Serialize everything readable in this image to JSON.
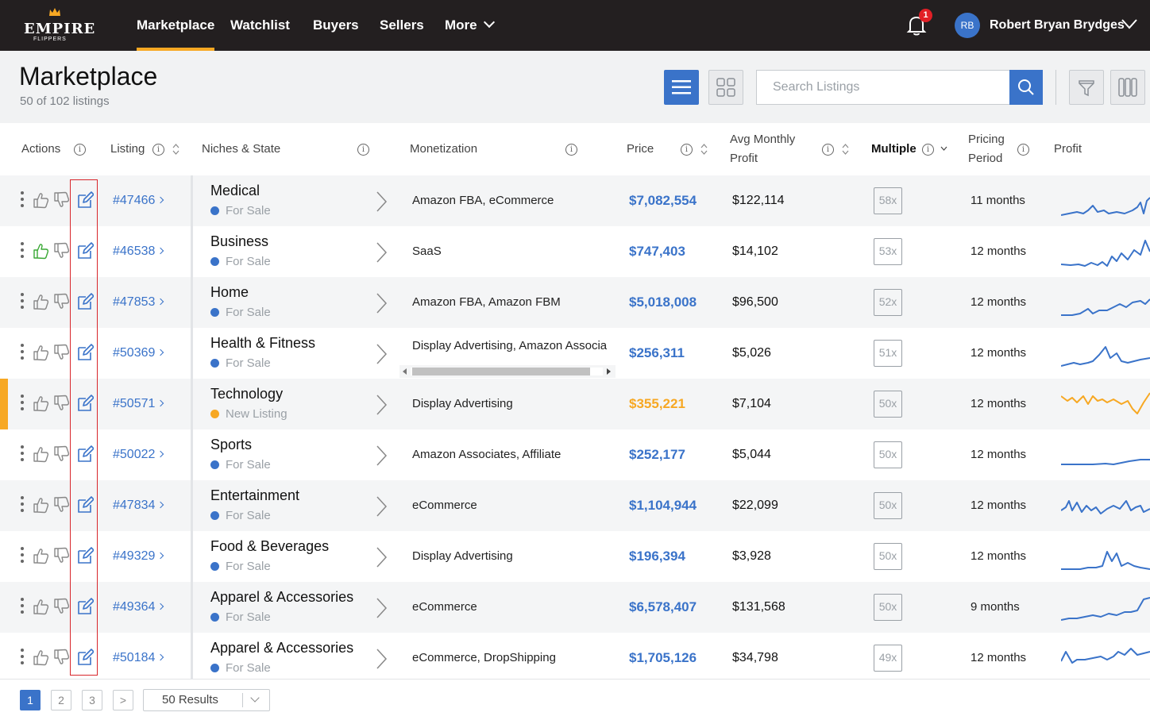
{
  "nav": {
    "logo_text": "EMPIRE",
    "logo_sub": "FLIPPERS",
    "items": [
      {
        "label": "Marketplace",
        "active": true
      },
      {
        "label": "Watchlist"
      },
      {
        "label": "Buyers"
      },
      {
        "label": "Sellers"
      },
      {
        "label": "More"
      }
    ],
    "notification_count": "1",
    "user_initials": "RB",
    "user_name": "Robert Bryan Brydges"
  },
  "header": {
    "title": "Marketplace",
    "subtitle": "50 of 102 listings",
    "search_placeholder": "Search Listings"
  },
  "columns": {
    "actions": "Actions",
    "listing": "Listing",
    "niches": "Niches & State",
    "monetization": "Monetization",
    "price": "Price",
    "avg_profit_1": "Avg Monthly",
    "avg_profit_2": "Profit",
    "multiple": "Multiple",
    "pricing_1": "Pricing",
    "pricing_2": "Period",
    "profit": "Profit"
  },
  "rows": [
    {
      "id": "#47466",
      "niche": "Medical",
      "state": "For Sale",
      "monetization": "Amazon FBA, eCommerce",
      "price": "$7,082,554",
      "profit": "$122,114",
      "multiple": "58x",
      "period": "11 months"
    },
    {
      "id": "#46538",
      "niche": "Business",
      "state": "For Sale",
      "monetization": "SaaS",
      "price": "$747,403",
      "profit": "$14,102",
      "multiple": "53x",
      "period": "12 months"
    },
    {
      "id": "#47853",
      "niche": "Home",
      "state": "For Sale",
      "monetization": "Amazon FBA, Amazon FBM",
      "price": "$5,018,008",
      "profit": "$96,500",
      "multiple": "52x",
      "period": "12 months"
    },
    {
      "id": "#50369",
      "niche": "Health & Fitness",
      "state": "For Sale",
      "monetization": "Display Advertising, Amazon Associa",
      "price": "$256,311",
      "profit": "$5,026",
      "multiple": "51x",
      "period": "12 months"
    },
    {
      "id": "#50571",
      "niche": "Technology",
      "state": "New Listing",
      "monetization": "Display Advertising",
      "price": "$355,221",
      "profit": "$7,104",
      "multiple": "50x",
      "period": "12 months"
    },
    {
      "id": "#50022",
      "niche": "Sports",
      "state": "For Sale",
      "monetization": "Amazon Associates, Affiliate",
      "price": "$252,177",
      "profit": "$5,044",
      "multiple": "50x",
      "period": "12 months"
    },
    {
      "id": "#47834",
      "niche": "Entertainment",
      "state": "For Sale",
      "monetization": "eCommerce",
      "price": "$1,104,944",
      "profit": "$22,099",
      "multiple": "50x",
      "period": "12 months"
    },
    {
      "id": "#49329",
      "niche": "Food & Beverages",
      "state": "For Sale",
      "monetization": "Display Advertising",
      "price": "$196,394",
      "profit": "$3,928",
      "multiple": "50x",
      "period": "12 months"
    },
    {
      "id": "#49364",
      "niche": "Apparel & Accessories",
      "state": "For Sale",
      "monetization": "eCommerce",
      "price": "$6,578,407",
      "profit": "$131,568",
      "multiple": "50x",
      "period": "9 months"
    },
    {
      "id": "#50184",
      "niche": "Apparel & Accessories",
      "state": "For Sale",
      "monetization": "eCommerce, DropShipping",
      "price": "$1,705,126",
      "profit": "$34,798",
      "multiple": "49x",
      "period": "12 months"
    }
  ],
  "pagination": {
    "pages": [
      "1",
      "2",
      "3"
    ],
    "next": ">",
    "results_label": "50 Results"
  },
  "colors": {
    "accent": "#3a73c9",
    "new_listing": "#f7a823",
    "topbar": "#231f20",
    "liked": "#3aa835"
  }
}
